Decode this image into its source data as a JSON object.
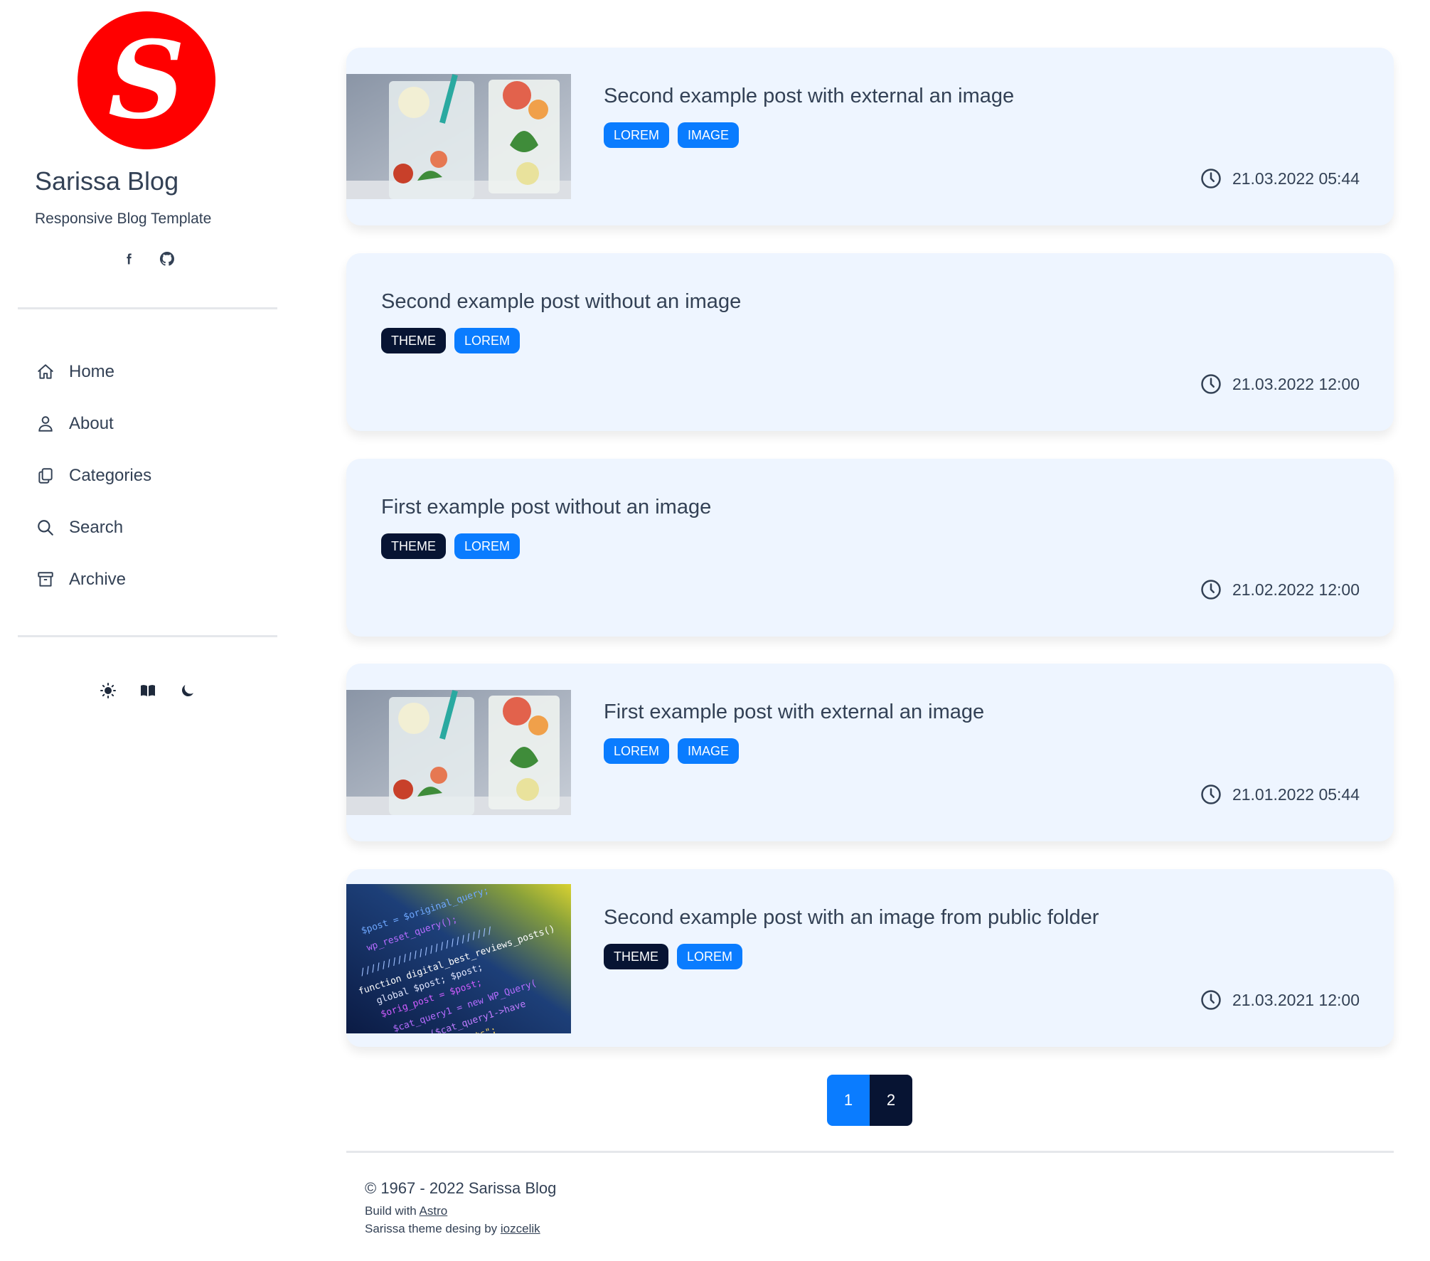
{
  "site": {
    "logo_letter": "S",
    "title": "Sarissa Blog",
    "subtitle": "Responsive Blog Template"
  },
  "social": [
    {
      "icon": "facebook-icon"
    },
    {
      "icon": "github-icon"
    }
  ],
  "nav": {
    "items": [
      {
        "label": "Home",
        "icon": "home-icon"
      },
      {
        "label": "About",
        "icon": "user-icon"
      },
      {
        "label": "Categories",
        "icon": "copy-icon"
      },
      {
        "label": "Search",
        "icon": "search-icon"
      },
      {
        "label": "Archive",
        "icon": "archive-icon"
      }
    ]
  },
  "theme_switch": [
    {
      "icon": "sun-icon"
    },
    {
      "icon": "book-icon"
    },
    {
      "icon": "moon-icon"
    }
  ],
  "posts": [
    {
      "title": "Second example post with external an image",
      "tags": [
        "LOREM",
        "IMAGE"
      ],
      "date": "21.03.2022 05:44",
      "image": "drinks-photo"
    },
    {
      "title": "Second example post without an image",
      "tags": [
        "THEME",
        "LOREM"
      ],
      "date": "21.03.2022 12:00",
      "image": ""
    },
    {
      "title": "First example post without an image",
      "tags": [
        "THEME",
        "LOREM"
      ],
      "date": "21.02.2022 12:00",
      "image": ""
    },
    {
      "title": "First example post with external an image",
      "tags": [
        "LOREM",
        "IMAGE"
      ],
      "date": "21.01.2022 05:44",
      "image": "drinks-photo"
    },
    {
      "title": "Second example post with an image from public folder",
      "tags": [
        "THEME",
        "LOREM"
      ],
      "date": "21.03.2021 12:00",
      "image": "code-photo"
    }
  ],
  "pagination": {
    "pages": [
      "1",
      "2"
    ],
    "current": "1"
  },
  "footer": {
    "copyright": "© 1967 - 2022 Sarissa Blog",
    "build_prefix": "Build with ",
    "build_link": "Astro",
    "theme_prefix": "Sarissa theme desing by ",
    "theme_link": "iozcelik"
  },
  "colors": {
    "accent": "#0a7cff",
    "dark": "#071433",
    "logo": "#ff0000",
    "card_bg": "#eef5ff"
  }
}
